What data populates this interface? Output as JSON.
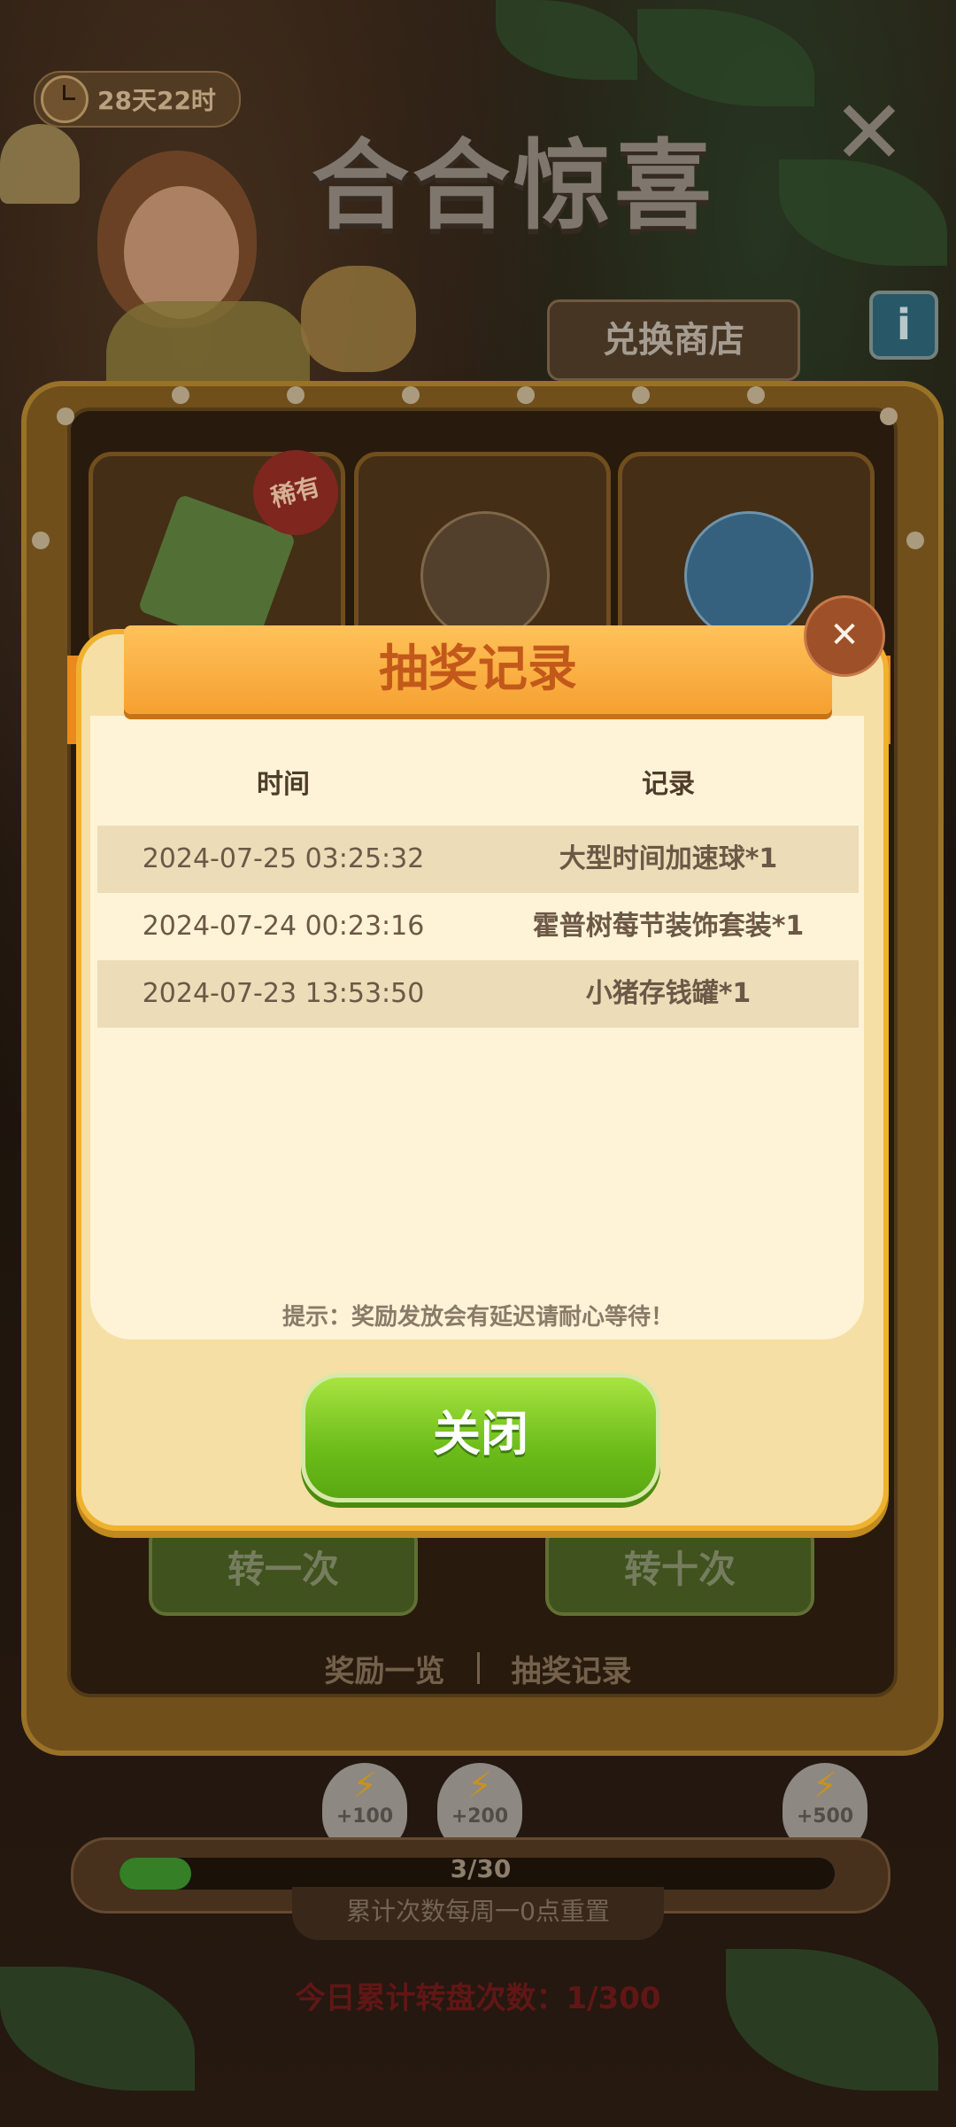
{
  "header": {
    "timer": "28天22时",
    "title": "合合惊喜",
    "shop_label": "兑换商店",
    "info_label": "i"
  },
  "wheel": {
    "rare_badge": "稀有",
    "spin_once": "转一次",
    "spin_ten": "转十次",
    "link_rewards": "奖励一览",
    "link_records": "抽奖记录"
  },
  "progress": {
    "milestones": [
      "+100",
      "+200",
      "+500"
    ],
    "text": "3/30",
    "current": 3,
    "total": 30,
    "reset_tip": "累计次数每周一0点重置",
    "today_count": "今日累计转盘次数：1/300"
  },
  "modal": {
    "title": "抽奖记录",
    "close_icon": "close-icon",
    "col_time": "时间",
    "col_record": "记录",
    "rows": [
      {
        "time": "2024-07-25 03:25:32",
        "record": "大型时间加速球*1"
      },
      {
        "time": "2024-07-24 00:23:16",
        "record": "霍普树莓节装饰套装*1"
      },
      {
        "time": "2024-07-23 13:53:50",
        "record": "小猪存钱罐*1"
      }
    ],
    "tip": "提示：奖励发放会有延迟请耐心等待！",
    "close_button": "关闭"
  },
  "colors": {
    "modal_bg": "#fef3d7",
    "ribbon": "#f5a030",
    "title": "#c2591a",
    "green_button": "#6cbc1a"
  }
}
